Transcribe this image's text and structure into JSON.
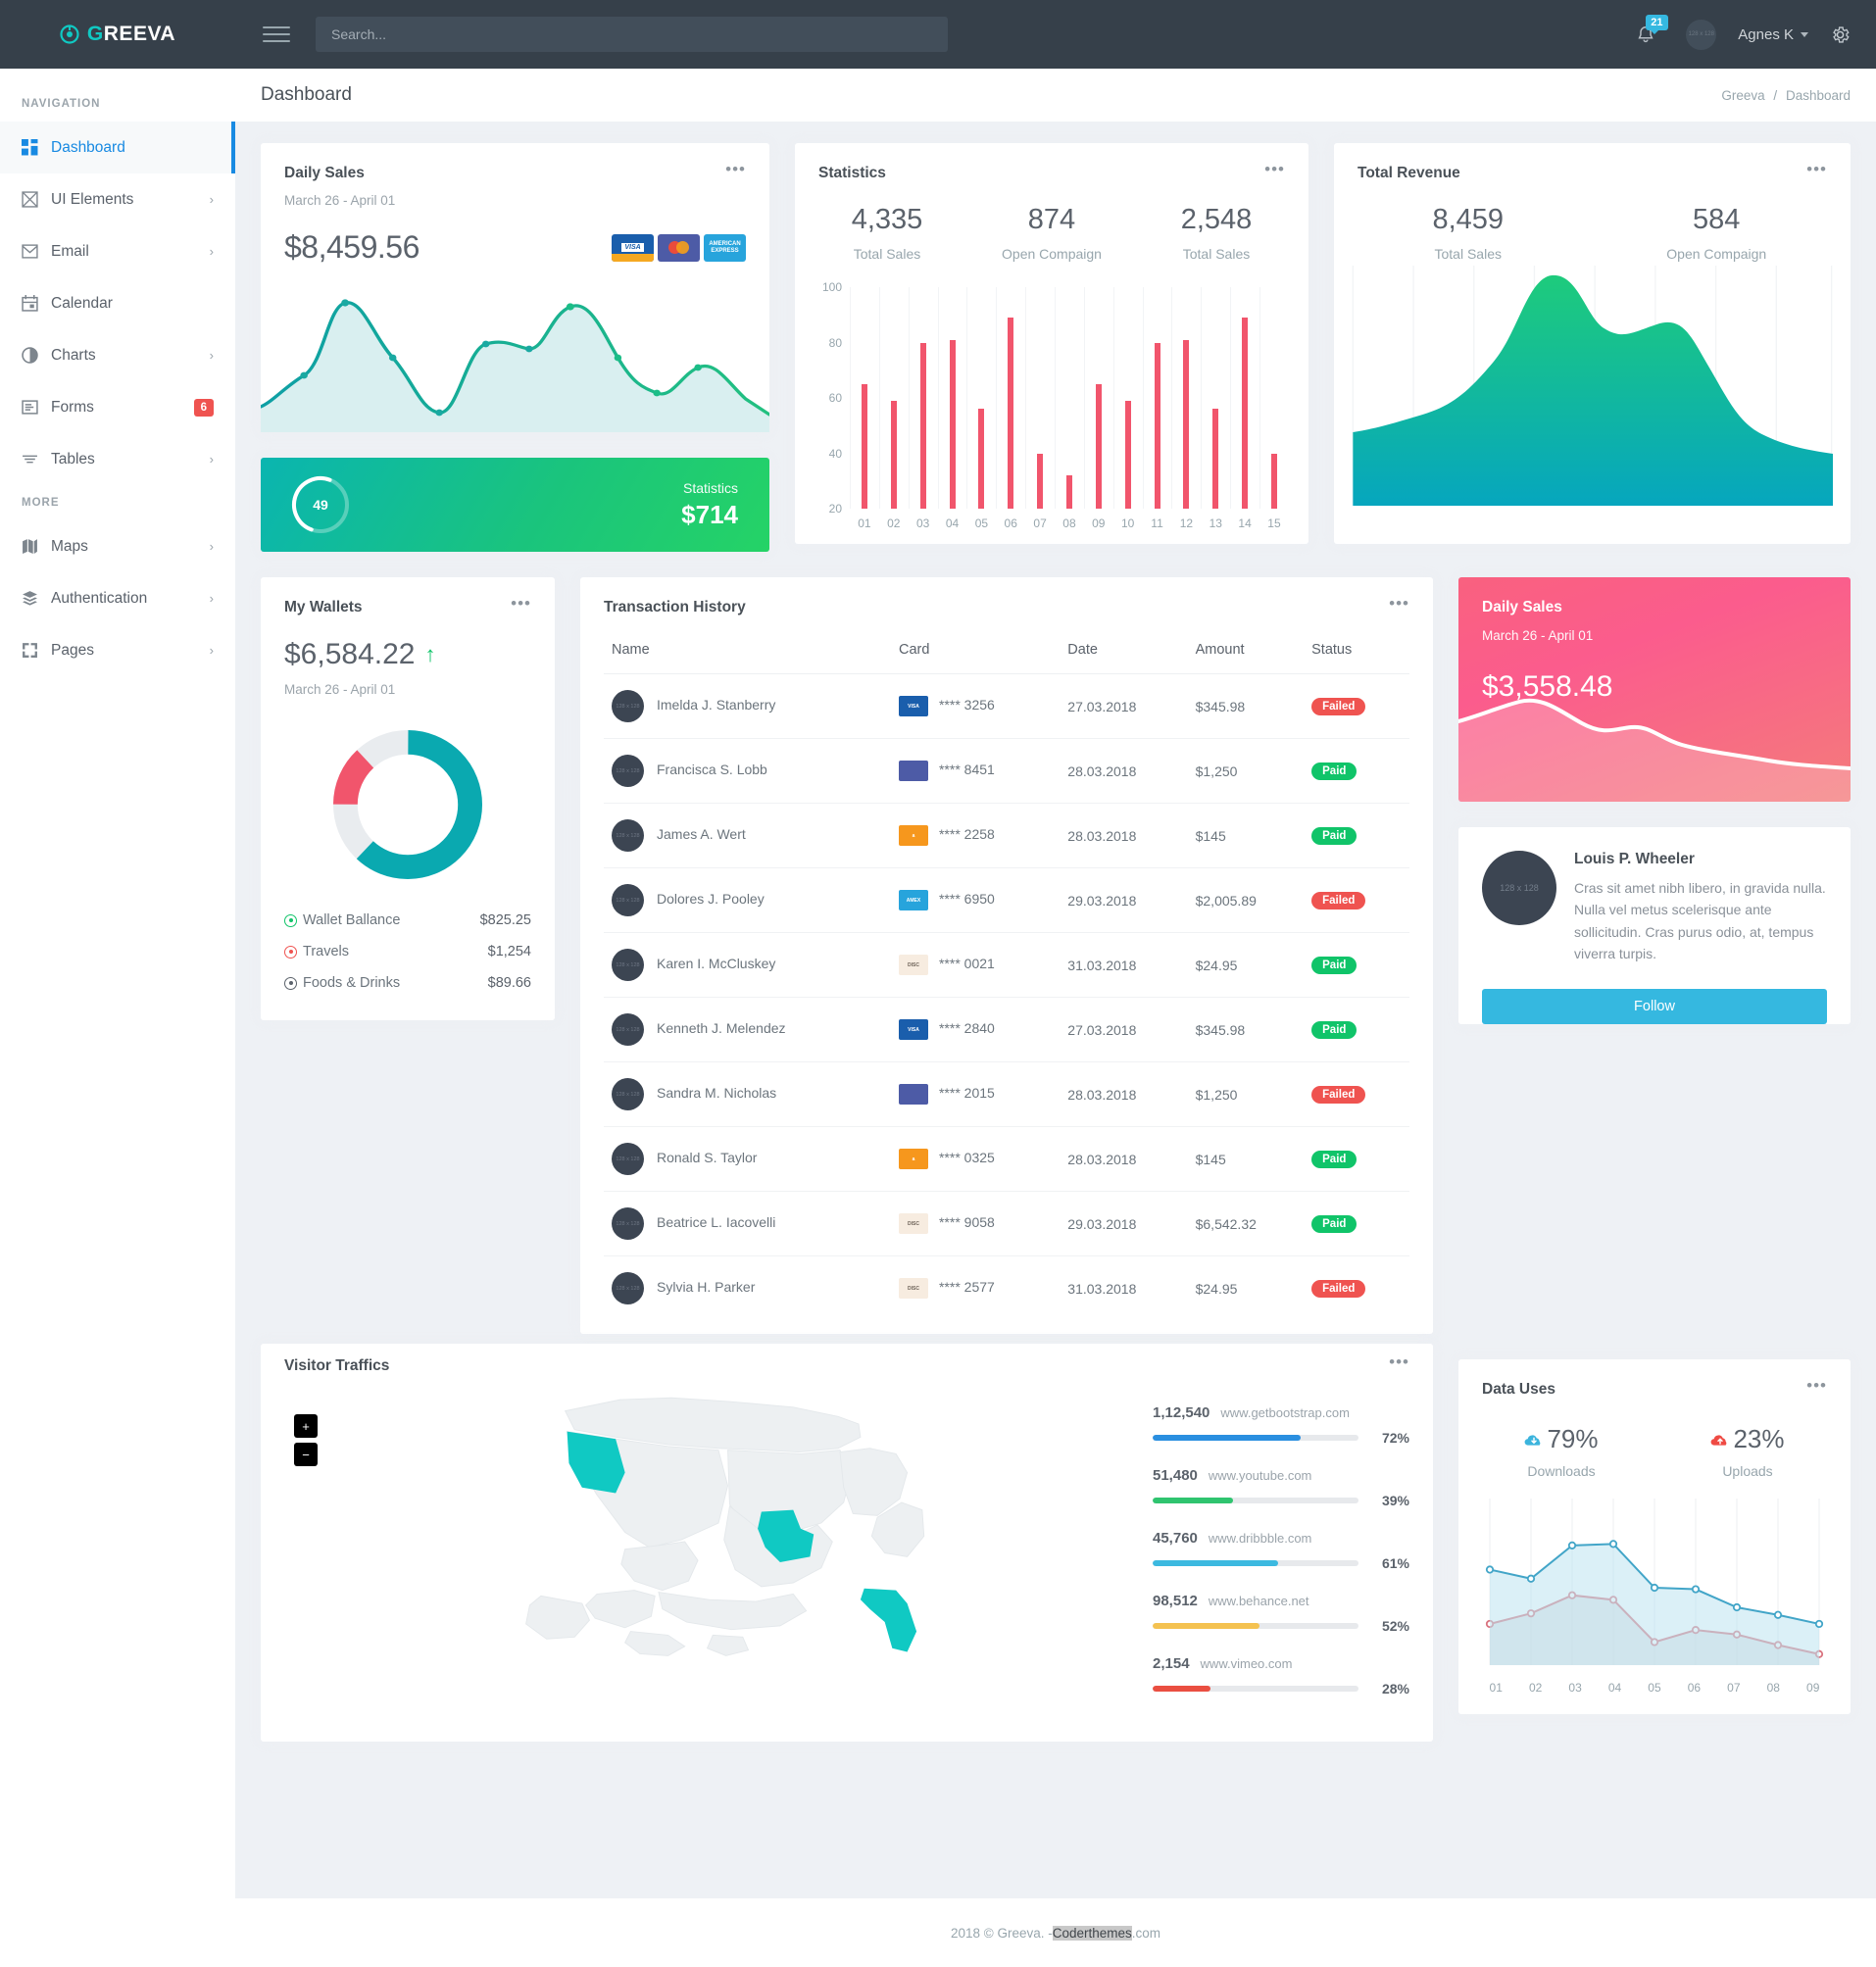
{
  "topbar": {
    "brand": "GREEVA",
    "brand_first": "G",
    "brand_rest": "REEVA",
    "search_placeholder": "Search...",
    "notification_count": "21",
    "user_name": "Agnes K",
    "avatar_label": "128 x 128"
  },
  "sidebar": {
    "section_nav": "NAVIGATION",
    "section_more": "MORE",
    "items": [
      {
        "label": "Dashboard",
        "icon": "dashboard-icon",
        "active": true,
        "chevron": false,
        "badge": ""
      },
      {
        "label": "UI Elements",
        "icon": "ui-elements-icon",
        "active": false,
        "chevron": true,
        "badge": ""
      },
      {
        "label": "Email",
        "icon": "email-icon",
        "active": false,
        "chevron": true,
        "badge": ""
      },
      {
        "label": "Calendar",
        "icon": "calendar-icon",
        "active": false,
        "chevron": false,
        "badge": ""
      },
      {
        "label": "Charts",
        "icon": "charts-icon",
        "active": false,
        "chevron": true,
        "badge": ""
      },
      {
        "label": "Forms",
        "icon": "forms-icon",
        "active": false,
        "chevron": false,
        "badge": "6"
      },
      {
        "label": "Tables",
        "icon": "tables-icon",
        "active": false,
        "chevron": true,
        "badge": ""
      }
    ],
    "more_items": [
      {
        "label": "Maps",
        "icon": "maps-icon",
        "chevron": true
      },
      {
        "label": "Authentication",
        "icon": "layers-icon",
        "chevron": true
      },
      {
        "label": "Pages",
        "icon": "pages-icon",
        "chevron": true
      }
    ]
  },
  "page": {
    "title": "Dashboard",
    "breadcrumb_root": "Greeva",
    "breadcrumb_sep": "/",
    "breadcrumb_current": "Dashboard"
  },
  "daily_sales": {
    "title": "Daily Sales",
    "date_range": "March 26 - April 01",
    "amount": "$8,459.56",
    "cards": [
      "VISA",
      "MasterCard",
      "AMERICAN EXPRESS"
    ]
  },
  "green_stat": {
    "ring_value": "49",
    "label": "Statistics",
    "value": "$714"
  },
  "statistics": {
    "title": "Statistics",
    "metrics": [
      {
        "value": "4,335",
        "label": "Total Sales"
      },
      {
        "value": "874",
        "label": "Open Compaign"
      },
      {
        "value": "2,548",
        "label": "Total Sales"
      }
    ]
  },
  "total_revenue": {
    "title": "Total Revenue",
    "metrics": [
      {
        "value": "8,459",
        "label": "Total Sales"
      },
      {
        "value": "584",
        "label": "Open Compaign"
      }
    ]
  },
  "my_wallets": {
    "title": "My Wallets",
    "amount": "$6,584.22",
    "trend": "up",
    "date_range": "March 26 - April 01",
    "legend": [
      {
        "label": "Wallet Ballance",
        "amount": "$825.25",
        "color": "#10c469"
      },
      {
        "label": "Travels",
        "amount": "$1,254",
        "color": "#ef5350"
      },
      {
        "label": "Foods & Drinks",
        "amount": "$89.66",
        "color": "#5b626b"
      }
    ]
  },
  "transactions": {
    "title": "Transaction History",
    "columns": [
      "Name",
      "Card",
      "Date",
      "Amount",
      "Status"
    ],
    "rows": [
      {
        "name": "Imelda J. Stanberry",
        "brand": "visa",
        "card": "**** 3256",
        "date": "27.03.2018",
        "amount": "$345.98",
        "status": "Failed"
      },
      {
        "name": "Francisca S. Lobb",
        "brand": "mastercard",
        "card": "**** 8451",
        "date": "28.03.2018",
        "amount": "$1,250",
        "status": "Paid"
      },
      {
        "name": "James A. Wert",
        "brand": "amazon",
        "card": "**** 2258",
        "date": "28.03.2018",
        "amount": "$145",
        "status": "Paid"
      },
      {
        "name": "Dolores J. Pooley",
        "brand": "amex",
        "card": "**** 6950",
        "date": "29.03.2018",
        "amount": "$2,005.89",
        "status": "Failed"
      },
      {
        "name": "Karen I. McCluskey",
        "brand": "discover",
        "card": "**** 0021",
        "date": "31.03.2018",
        "amount": "$24.95",
        "status": "Paid"
      },
      {
        "name": "Kenneth J. Melendez",
        "brand": "visa",
        "card": "**** 2840",
        "date": "27.03.2018",
        "amount": "$345.98",
        "status": "Paid"
      },
      {
        "name": "Sandra M. Nicholas",
        "brand": "mastercard",
        "card": "**** 2015",
        "date": "28.03.2018",
        "amount": "$1,250",
        "status": "Failed"
      },
      {
        "name": "Ronald S. Taylor",
        "brand": "amazon",
        "card": "**** 0325",
        "date": "28.03.2018",
        "amount": "$145",
        "status": "Paid"
      },
      {
        "name": "Beatrice L. Iacovelli",
        "brand": "discover",
        "card": "**** 9058",
        "date": "29.03.2018",
        "amount": "$6,542.32",
        "status": "Paid"
      },
      {
        "name": "Sylvia H. Parker",
        "brand": "discover",
        "card": "**** 2577",
        "date": "31.03.2018",
        "amount": "$24.95",
        "status": "Failed"
      }
    ]
  },
  "pink_sales": {
    "title": "Daily Sales",
    "date_range": "March 26 - April 01",
    "amount": "$3,558.48"
  },
  "profile": {
    "avatar_label": "128 x 128",
    "name": "Louis P. Wheeler",
    "description": "Cras sit amet nibh libero, in gravida nulla. Nulla vel metus scelerisque ante sollicitudin. Cras purus odio, at, tempus viverra turpis.",
    "follow_label": "Follow"
  },
  "visitor_traffics": {
    "title": "Visitor Traffics",
    "zoom_in": "+",
    "zoom_out": "−",
    "highlighted_states": [
      "Oregon",
      "Missouri",
      "Florida"
    ],
    "sites": [
      {
        "count": "1,12,540",
        "url": "www.getbootstrap.com",
        "percent": "72%",
        "value": 72,
        "color": "#2a8fe0"
      },
      {
        "count": "51,480",
        "url": "www.youtube.com",
        "percent": "39%",
        "value": 39,
        "color": "#2fc46f"
      },
      {
        "count": "45,760",
        "url": "www.dribbble.com",
        "percent": "61%",
        "value": 61,
        "color": "#3cb9e0"
      },
      {
        "count": "98,512",
        "url": "www.behance.net",
        "percent": "52%",
        "value": 52,
        "color": "#f4c251"
      },
      {
        "count": "2,154",
        "url": "www.vimeo.com",
        "percent": "28%",
        "value": 28,
        "color": "#ea4f41"
      }
    ]
  },
  "data_uses": {
    "title": "Data Uses",
    "downloads_pct": "79%",
    "downloads_label": "Downloads",
    "uploads_pct": "23%",
    "uploads_label": "Uploads"
  },
  "footer": {
    "text_before": "2018 © Greeva. - ",
    "highlight": "Coderthemes",
    "text_after": ".com"
  },
  "colors": {
    "accent_teal": "#10c9c3",
    "accent_blue": "#188ae2",
    "danger": "#ef5350",
    "success": "#10c469",
    "pink": "#f9617f",
    "bar_pink": "#f1556c",
    "sidebar_bg": "#ffffff",
    "topbar_bg": "#36404a",
    "page_bg": "#eef1f5"
  },
  "chart_data": [
    {
      "type": "area",
      "name": "daily-sales-sparkline",
      "title": "Daily Sales",
      "x": [
        "1",
        "2",
        "3",
        "4",
        "5",
        "6",
        "7",
        "8",
        "9",
        "10",
        "11",
        "12"
      ],
      "values": [
        20,
        45,
        90,
        55,
        15,
        55,
        52,
        88,
        50,
        28,
        40,
        22
      ],
      "ylim": [
        0,
        100
      ],
      "line_color": "#17a2a2",
      "fill_color": "#d9eff0",
      "grid": false,
      "legend": "none"
    },
    {
      "type": "bar",
      "name": "statistics-bars",
      "title": "Statistics",
      "categories": [
        "01",
        "02",
        "03",
        "04",
        "05",
        "06",
        "07",
        "08",
        "09",
        "10",
        "11",
        "12",
        "13",
        "14",
        "15"
      ],
      "values": [
        65,
        59,
        80,
        81,
        56,
        89,
        40,
        32,
        65,
        59,
        80,
        81,
        56,
        89,
        40
      ],
      "yticks": [
        20,
        40,
        60,
        80,
        100
      ],
      "ylim": [
        20,
        100
      ],
      "xlabel": "",
      "ylabel": "",
      "bar_color": "#f1556c",
      "grid": true,
      "legend": "none"
    },
    {
      "type": "area",
      "name": "total-revenue-area",
      "title": "Total Revenue",
      "x": [
        "1",
        "2",
        "3",
        "4",
        "5",
        "6",
        "7",
        "8",
        "9",
        "10"
      ],
      "values": [
        30,
        34,
        40,
        58,
        92,
        70,
        74,
        48,
        28,
        20
      ],
      "ylim": [
        0,
        100
      ],
      "gradient": [
        "#18c97f",
        "#0aa9bd"
      ],
      "grid": true,
      "legend": "none"
    },
    {
      "type": "pie",
      "name": "my-wallets-donut",
      "title": "My Wallets",
      "labels": [
        "Wallet Ballance",
        "Travels",
        "Foods & Drinks"
      ],
      "values": [
        62,
        13,
        25
      ],
      "colors": [
        "#0aa9b0",
        "#f1556c",
        "#e9ecef"
      ],
      "donut": true,
      "legend": "bottom"
    },
    {
      "type": "area",
      "name": "pink-daily-sales-sparkline",
      "title": "Daily Sales",
      "x": [
        "1",
        "2",
        "3",
        "4",
        "5",
        "6",
        "7",
        "8"
      ],
      "values": [
        46,
        50,
        62,
        56,
        44,
        46,
        30,
        24
      ],
      "ylim": [
        0,
        100
      ],
      "line_color": "#ffffff",
      "grid": false,
      "legend": "none"
    },
    {
      "type": "bar",
      "name": "visitor-traffic-bars",
      "title": "Visitor Traffics",
      "categories": [
        "www.getbootstrap.com",
        "www.youtube.com",
        "www.dribbble.com",
        "www.behance.net",
        "www.vimeo.com"
      ],
      "values": [
        72,
        39,
        61,
        52,
        28
      ],
      "counts": [
        "1,12,540",
        "51,480",
        "45,760",
        "98,512",
        "2,154"
      ],
      "ylim": [
        0,
        100
      ],
      "orientation": "horizontal",
      "colors": [
        "#2a8fe0",
        "#2fc46f",
        "#3cb9e0",
        "#f4c251",
        "#ea4f41"
      ],
      "grid": false,
      "legend": "none"
    },
    {
      "type": "line",
      "name": "data-uses-lines",
      "title": "Data Uses",
      "categories": [
        "01",
        "02",
        "03",
        "04",
        "05",
        "06",
        "07",
        "08",
        "09"
      ],
      "series": [
        {
          "name": "Downloads",
          "values": [
            62,
            56,
            78,
            79,
            50,
            49,
            37,
            32,
            26
          ],
          "color": "#42a5c8"
        },
        {
          "name": "Uploads",
          "values": [
            26,
            33,
            45,
            42,
            14,
            22,
            19,
            12,
            6
          ],
          "color": "#d9737f"
        }
      ],
      "ylim": [
        0,
        100
      ],
      "grid": true,
      "legend": "none"
    }
  ]
}
